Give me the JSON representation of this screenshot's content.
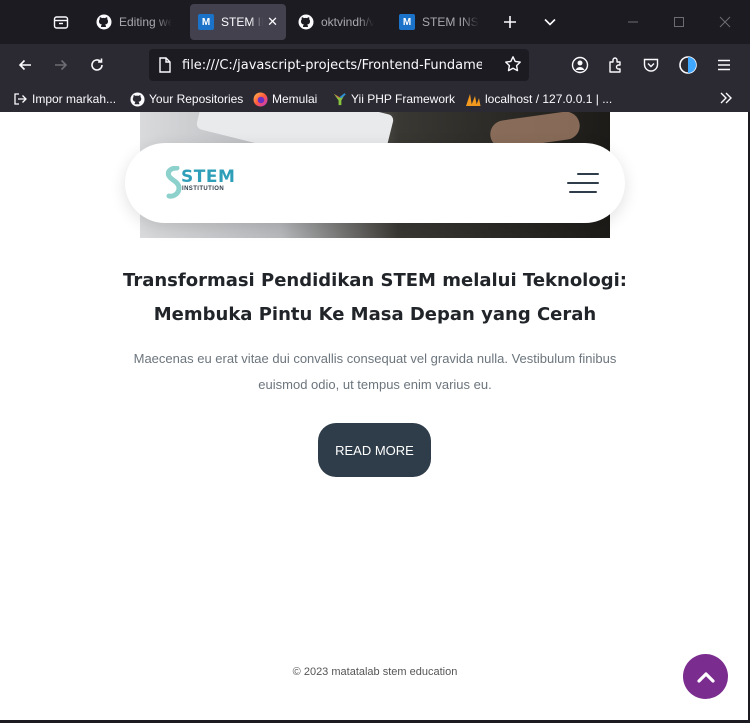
{
  "tabs": [
    {
      "title": "Editing wel",
      "icon": "github-icon",
      "active": false
    },
    {
      "title": "STEM IN",
      "icon": "m-favicon-icon",
      "active": true
    },
    {
      "title": "oktvindh/v",
      "icon": "github-icon",
      "active": false
    },
    {
      "title": "STEM INSTI",
      "icon": "m-favicon-icon",
      "active": false
    }
  ],
  "tab_favicon_letter": "M",
  "url": "file:///C:/javascript-projects/Frontend-Fundamental/",
  "bookmarks": [
    {
      "label": "Impor markah...",
      "icon": "import-icon"
    },
    {
      "label": "Your Repositories",
      "icon": "github-icon"
    },
    {
      "label": "Memulai",
      "icon": "firefox-icon"
    },
    {
      "label": "Yii PHP Framework",
      "icon": "yii-icon"
    },
    {
      "label": "localhost / 127.0.0.1 | ...",
      "icon": "phpmyadmin-icon"
    }
  ],
  "site": {
    "logo_text": "STEM",
    "logo_sub": "INSTITUTION",
    "article_title": "Transformasi Pendidikan STEM melalui Teknologi: Membuka Pintu Ke Masa Depan yang Cerah",
    "article_desc": "Maecenas eu erat vitae dui convallis consequat vel gravida nulla. Vestibulum finibus euismod odio, ut tempus enim varius eu.",
    "read_more": "READ MORE",
    "footer": "© 2023 matatalab stem education"
  },
  "colors": {
    "accent_dark": "#2f3d4a",
    "scroll_top": "#7b2c8f",
    "logo_teal": "#2f9fb9"
  }
}
